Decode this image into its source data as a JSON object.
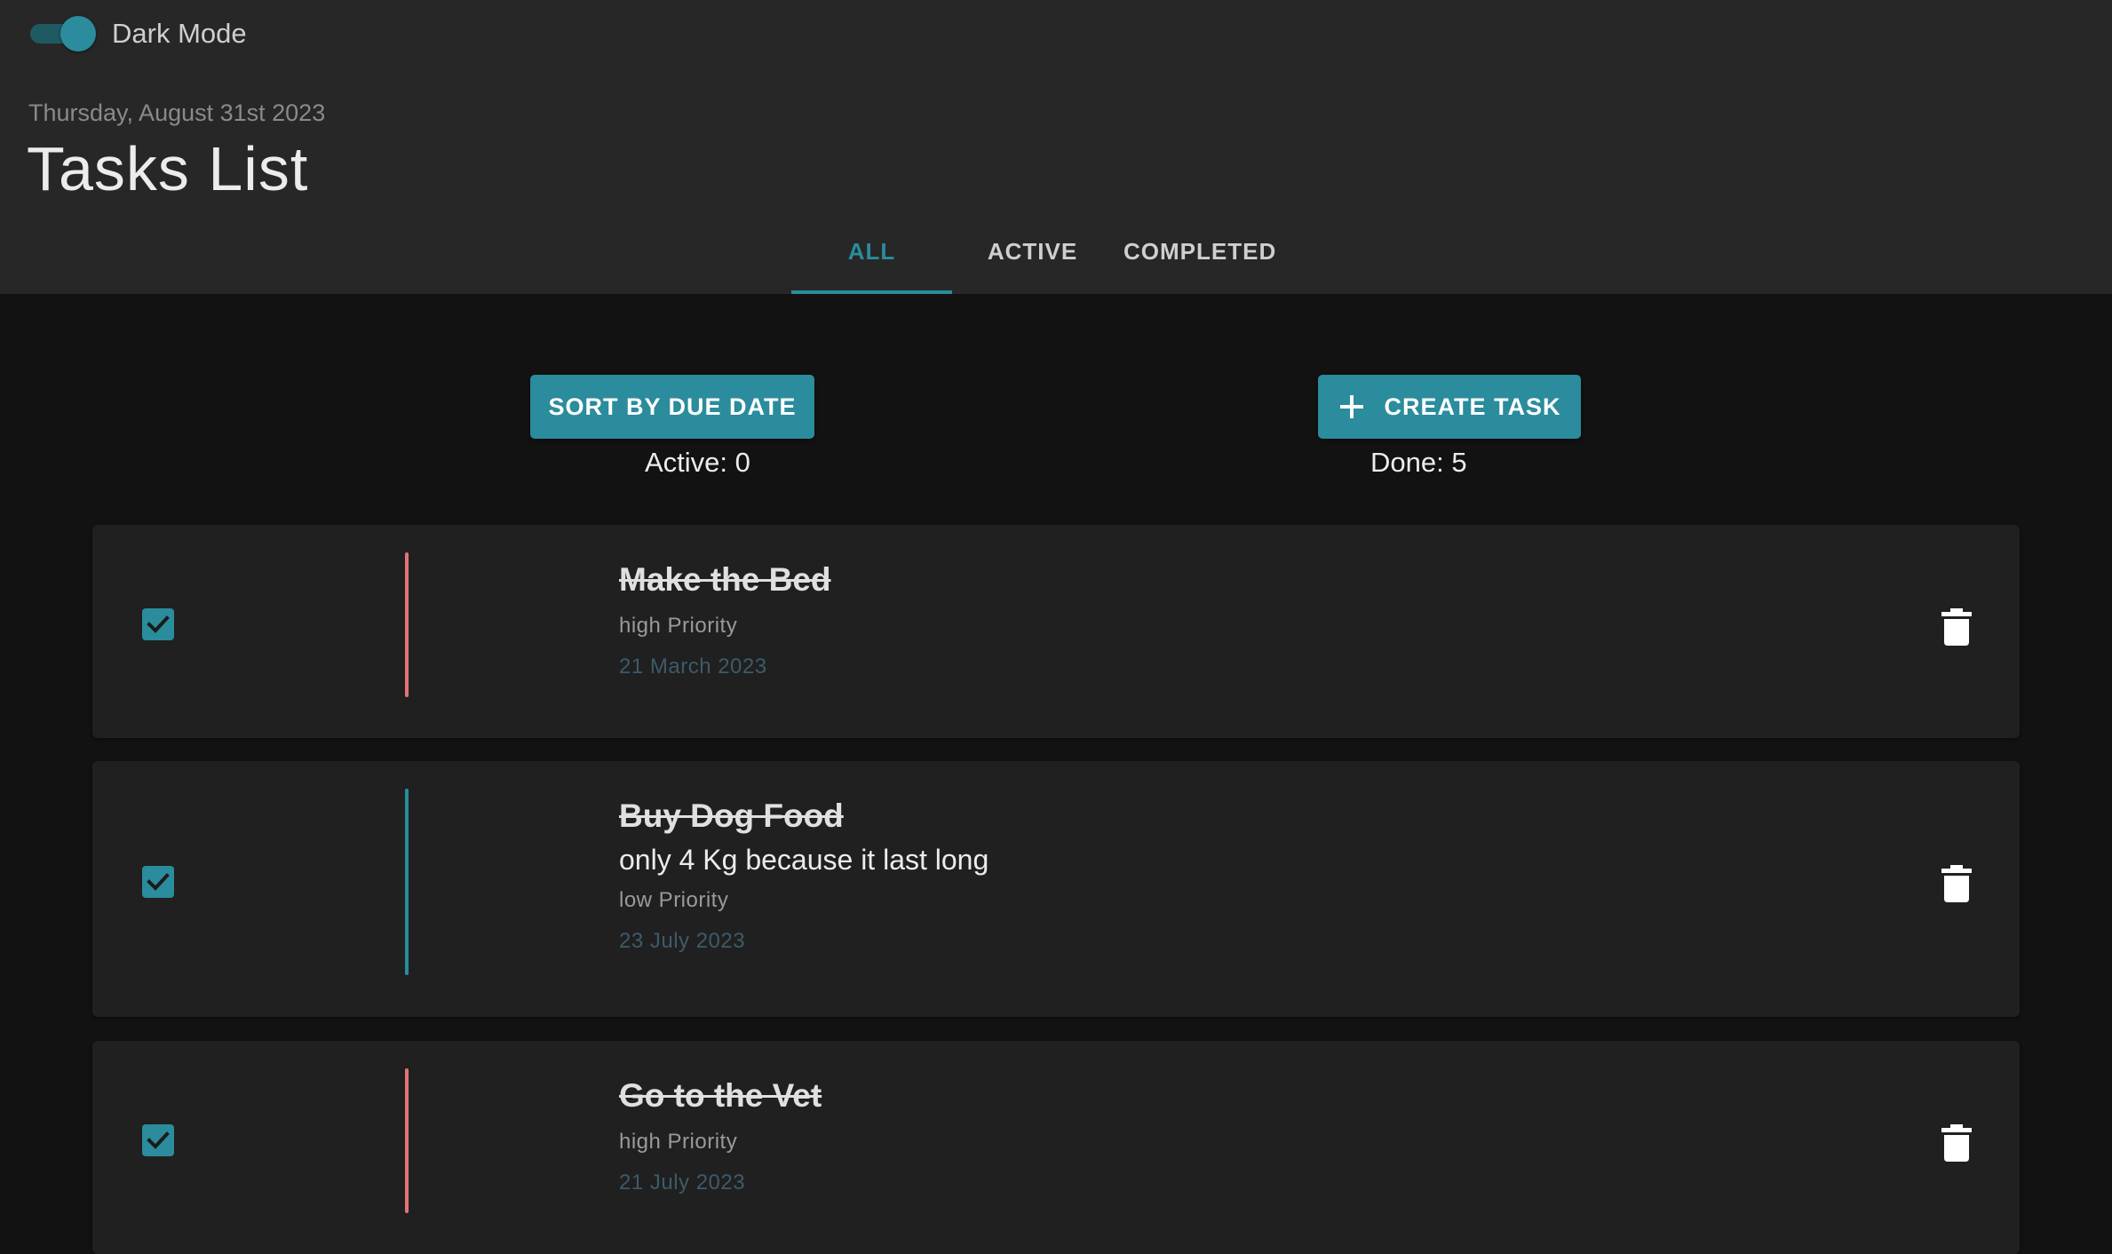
{
  "header": {
    "dark_mode_label": "Dark Mode",
    "dark_mode_on": true,
    "date": "Thursday, August 31st 2023",
    "title": "Tasks List"
  },
  "tabs": [
    {
      "label": "ALL",
      "selected": true
    },
    {
      "label": "ACTIVE",
      "selected": false
    },
    {
      "label": "COMPLETED",
      "selected": false
    }
  ],
  "toolbar": {
    "sort_label": "SORT BY DUE DATE",
    "create_label": "CREATE TASK",
    "create_icon": "plus-icon"
  },
  "counters": {
    "active": "Active: 0",
    "done": "Done: 5"
  },
  "tasks": [
    {
      "title": "Make the Bed",
      "description": "",
      "priority": "high Priority",
      "due": "21 March 2023",
      "completed": true,
      "priority_color": "#e57373"
    },
    {
      "title": "Buy Dog Food",
      "description": "only 4 Kg because it last long",
      "priority": "low Priority",
      "due": "23 July 2023",
      "completed": true,
      "priority_color": "#2a8c9c"
    },
    {
      "title": "Go to the Vet",
      "description": "",
      "priority": "high Priority",
      "due": "21 July 2023",
      "completed": true,
      "priority_color": "#e57373"
    }
  ],
  "colors": {
    "accent": "#2a8c9c",
    "background": "#121212",
    "appbar": "#272727",
    "card": "#202020",
    "high_priority": "#e57373",
    "low_priority": "#2a8c9c"
  }
}
